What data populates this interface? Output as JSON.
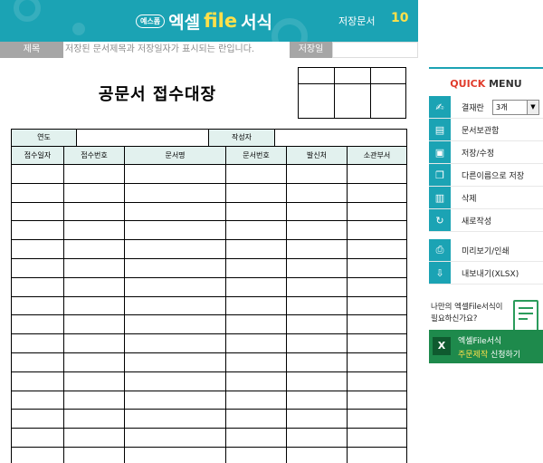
{
  "header": {
    "logo_badge": "예스폼",
    "logo_main": "엑셀",
    "logo_file": "file",
    "logo_suffix": "서식",
    "saved_label": "저장문서",
    "saved_count": "10"
  },
  "title_bar": {
    "title_label": "제목",
    "title_hint": "저장된 문서제목과 저장일자가 표시되는 란입니다.",
    "date_label": "저장일"
  },
  "document": {
    "title": "공문서 접수대장",
    "meta": {
      "year_label": "연도",
      "author_label": "작성자"
    },
    "columns": [
      "접수일자",
      "접수번호",
      "문서명",
      "문서번호",
      "발신처",
      "소관부서"
    ]
  },
  "quick_menu": {
    "title_quick": "QUICK",
    "title_menu": "MENU",
    "approval_label": "결재란",
    "approval_value": "3개",
    "items": [
      {
        "label": "문서보관함",
        "icon": "archive-icon"
      },
      {
        "label": "저장/수정",
        "icon": "save-icon"
      },
      {
        "label": "다른이름으로 저장",
        "icon": "copy-icon"
      },
      {
        "label": "삭제",
        "icon": "trash-icon"
      },
      {
        "label": "새로작성",
        "icon": "refresh-icon"
      }
    ],
    "items2": [
      {
        "label": "미리보기/인쇄",
        "icon": "print-icon"
      },
      {
        "label": "내보내기(XLSX)",
        "icon": "export-icon"
      }
    ]
  },
  "promo": {
    "line1": "나만의 엑셀File서식이",
    "line2": "필요하신가요?",
    "btn_line1": "엑셀File서식",
    "btn_highlight": "주문제작",
    "btn_rest": " 신청하기",
    "x_label": "X"
  },
  "colors": {
    "brand": "#1ba3b4",
    "accent": "#ffe04a",
    "green": "#1e8a4c",
    "header_fill": "#e2f1ee"
  }
}
